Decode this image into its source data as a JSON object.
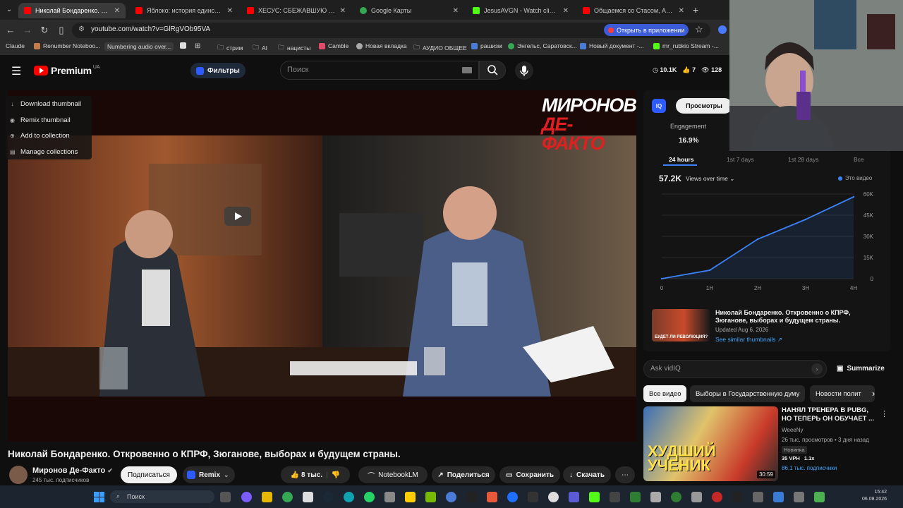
{
  "browser": {
    "tabs": [
      {
        "title": "Николай Бондаренко. Откровенно о КПРФ",
        "color": "#ff0000",
        "active": true
      },
      {
        "title": "Яблоко: история единственной",
        "color": "#ff0000"
      },
      {
        "title": "ХЕСУС: СБЕЖАВШУЮ ИЗ РФ",
        "color": "#ff0000"
      },
      {
        "title": "Google Карты",
        "color": "#34a853"
      },
      {
        "title": "JesusAVGN - Watch clips on Kick",
        "color": "#53fc18"
      },
      {
        "title": "Общаемся со Стасом, Ай как",
        "color": "#ff0000"
      }
    ],
    "new_tab": "+",
    "url": "youtube.com/watch?v=GlRgVOb95VA",
    "open_in_app": "Открыть в приложении",
    "bookmarks": [
      "Claude",
      "Renumber Noteboo...",
      "Numbering audio over...",
      "стрим",
      "AI",
      "нацисты",
      "Camble",
      "Новая вкладка",
      "АУДИО ОБЩЕЕ",
      "рашизм",
      "Энгельс, Саратовск...",
      "Новый документ -...",
      "mr_rubkio Stream -..."
    ]
  },
  "youtube": {
    "logo_text": "Premium",
    "logo_region": "UA",
    "filters_label": "Фильтры",
    "search_placeholder": "Поиск",
    "header_stats": {
      "views": "10.1K",
      "likes": "7",
      "watching": "128"
    }
  },
  "player": {
    "brand_line1": "МИРОНОВ",
    "brand_line2": "ДЕ-ФАКТО",
    "menu": [
      "Download thumbnail",
      "Remix thumbnail",
      "Add to collection",
      "Manage collections"
    ]
  },
  "video": {
    "title": "Николай Бондаренко. Откровенно о КПРФ, Зюганове, выборах и будущем страны.",
    "channel": "Миронов Де-Факто",
    "subscribers": "245 тыс. подписчиков",
    "subscribe_label": "Подписаться",
    "remix_label": "Remix",
    "likes": "8 тыс.",
    "notebooklm_label": "NotebookLM",
    "share_label": "Поделиться",
    "save_label": "Сохранить",
    "download_label": "Скачать"
  },
  "analytics": {
    "logo": "IQ",
    "views_tab": "Просмотры",
    "engagement_label": "Engagement",
    "engagement_value": "16.9%",
    "ranges": [
      "24 hours",
      "1st 7 days",
      "1st 28 days",
      "Все"
    ],
    "selected_range": "24 hours",
    "views_total": "57.2K",
    "views_over_time": "Views over time",
    "this_video": "Это видео",
    "accent": "#3b82f6",
    "thumb_title": "Николай Бондаренко. Откровенно о КПРФ, Зюганове, выборах и будущем страны.",
    "thumb_caption": "БУДЕТ ЛИ РЕВОЛЮЦИЯ?",
    "thumb_updated": "Updated Aug 6, 2026",
    "see_similar": "See similar thumbnails ↗"
  },
  "chart_data": {
    "type": "line",
    "x": [
      "0",
      "1H",
      "2H",
      "3H",
      "4H"
    ],
    "values": [
      0,
      6,
      28,
      42,
      58
    ],
    "ylim": [
      0,
      60
    ],
    "yticks": [
      "0",
      "15K",
      "30K",
      "45K",
      "60K"
    ],
    "grid": true
  },
  "vidiq": {
    "ask_placeholder": "Ask vidIQ",
    "summarize_label": "Summarize"
  },
  "chips": [
    "Все видео",
    "Выборы в Государственную думу",
    "Новости полит"
  ],
  "recommendation": {
    "title": "НАНЯЛ ТРЕНЕРА В PUBG, НО ТЕПЕРЬ ОН ОБУЧАЕТ ...",
    "channel": "WeeeNy",
    "meta": "26 тыс. просмотров • 3 дня назад",
    "badge": "Новинка",
    "vph": "35 VPH",
    "ratio": "1.1x",
    "subs": "86.1 тыс. подписчики",
    "thumb_text": "ХУДШИЙ УЧЕНИК",
    "duration": "30:59"
  },
  "taskbar": {
    "search_placeholder": "Поиск",
    "time": "15:42",
    "date": "06.08.2026"
  }
}
